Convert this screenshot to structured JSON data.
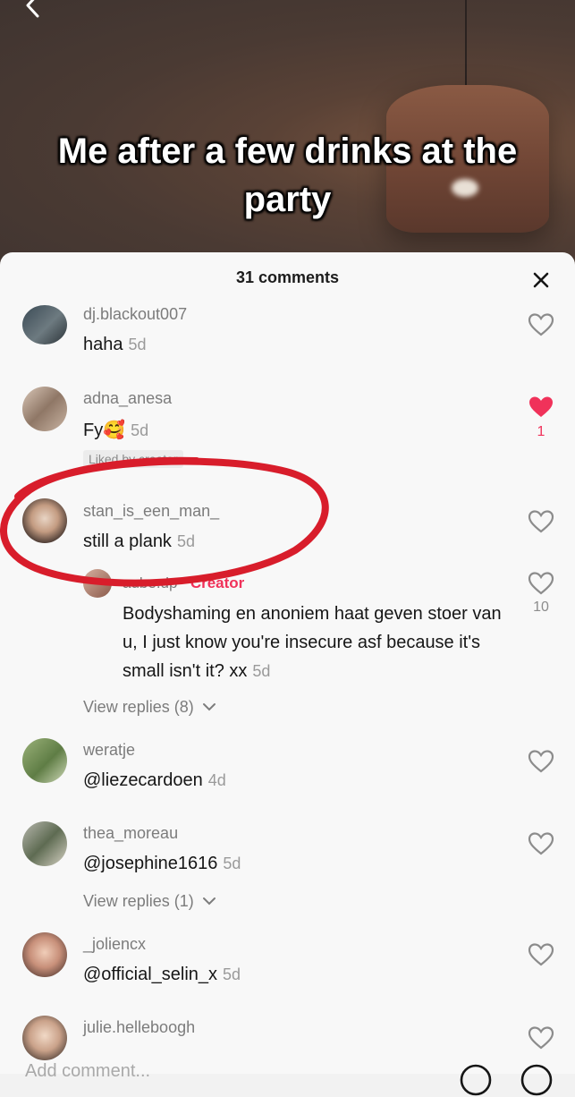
{
  "video": {
    "caption": "Me after a few drinks at the party"
  },
  "sheet": {
    "title": "31 comments",
    "add_comment_placeholder": "Add comment..."
  },
  "comments": [
    {
      "username": "dj.blackout007",
      "text": "haha",
      "time": "5d"
    },
    {
      "username": "adna_anesa",
      "text": "Fy🥰",
      "time": "5d",
      "liked": true,
      "like_count": "1",
      "badge": "Liked by creator"
    },
    {
      "username": "stan_is_een_man_",
      "text": "still a plank",
      "time": "5d",
      "reply": {
        "username": "aube.dp",
        "role": "· Creator",
        "text": "Bodyshaming en anoniem haat geven stoer van u, I just know you're insecure asf because it's small isn't it? xx",
        "time": "5d",
        "like_count": "10"
      },
      "view_replies": "View replies (8)"
    },
    {
      "username": "weratje",
      "text": "@liezecardoen",
      "time": "4d"
    },
    {
      "username": "thea_moreau",
      "text": "@josephine1616",
      "time": "5d",
      "view_replies": "View replies (1)"
    },
    {
      "username": "_joliencx",
      "text": "@official_selin_x",
      "time": "5d"
    },
    {
      "username": "julie.helleboogh"
    }
  ],
  "colors": {
    "accent": "#f0325a",
    "annotation": "#d81d2b"
  }
}
